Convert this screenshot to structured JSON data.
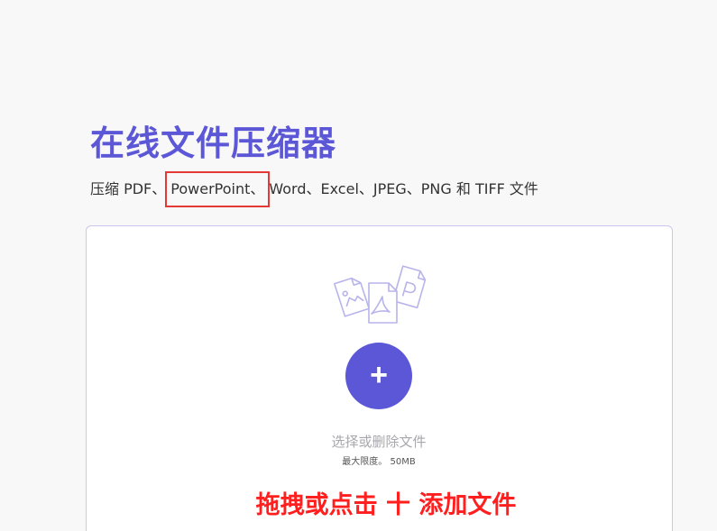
{
  "page": {
    "title": "在线文件压缩器",
    "subtitle_prefix": "压缩 PDF、",
    "subtitle_highlight": "PowerPoint、",
    "subtitle_suffix": "Word、Excel、JPEG、PNG 和 TIFF 文件"
  },
  "dropzone": {
    "add_button_label": "+",
    "select_text": "选择或删除文件",
    "limit_text": "最大限度。 50MB",
    "illustration_icon": "document-stack-icon"
  },
  "overlay": {
    "instruction": "拖拽或点击 十 添加文件",
    "color": "#ff1f1f"
  },
  "colors": {
    "accent": "#5b57d6",
    "highlight_border": "#e53935"
  }
}
